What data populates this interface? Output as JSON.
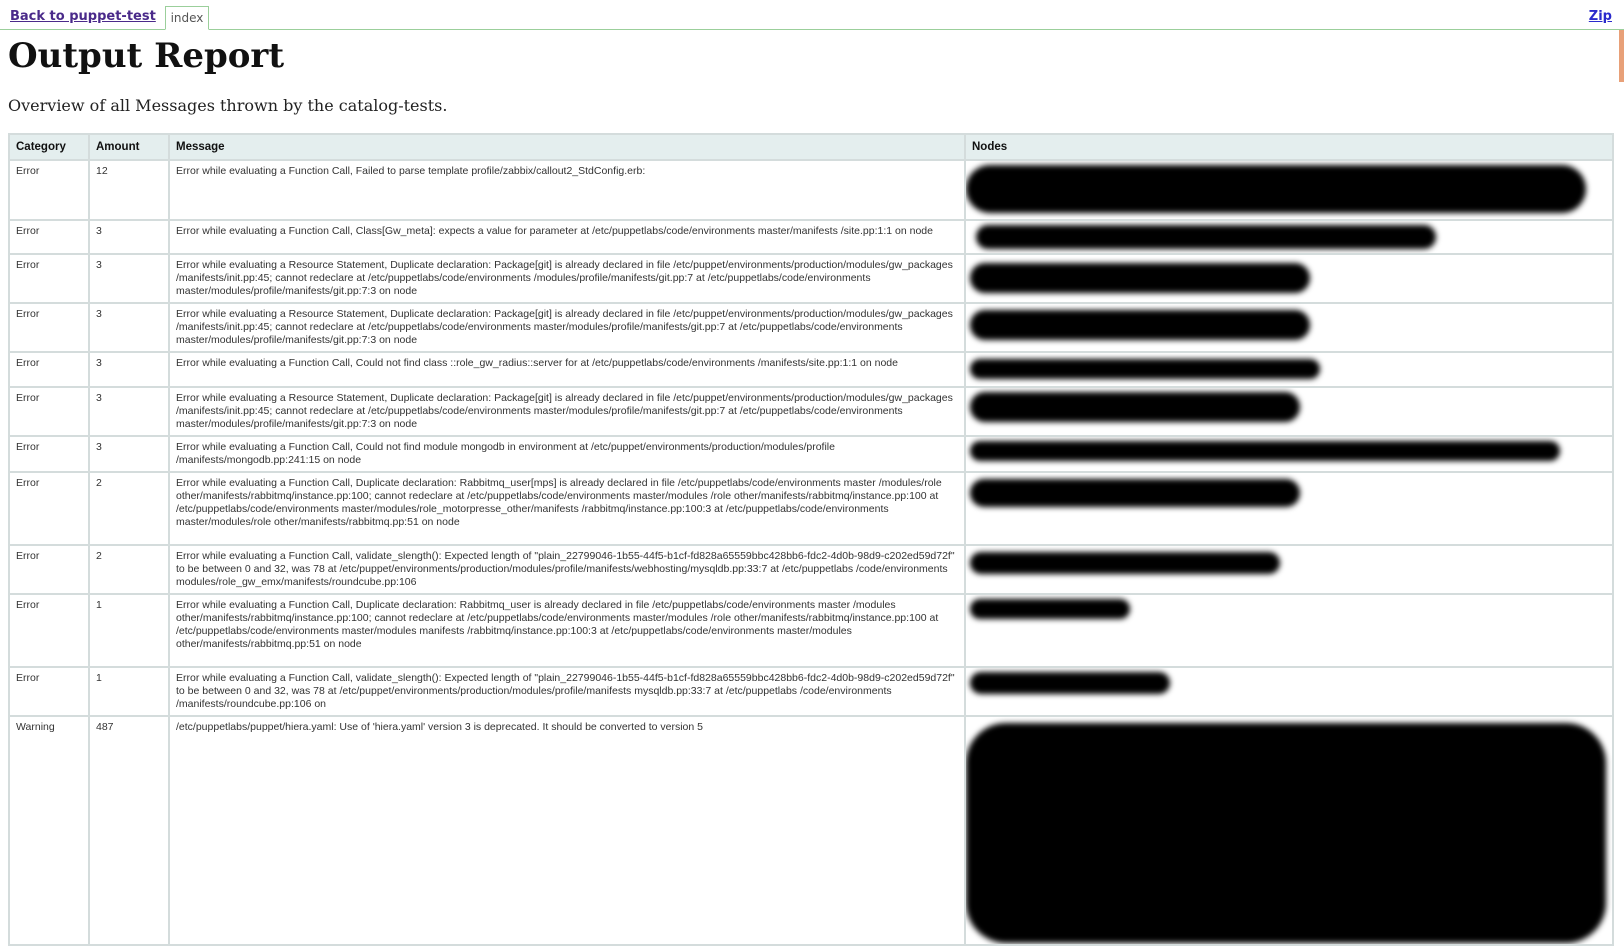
{
  "nav": {
    "back_label": "Back to puppet-test",
    "tab_label": "index",
    "zip_label": "Zip"
  },
  "page": {
    "title": "Output Report",
    "subtitle": "Overview of all Messages thrown by the catalog-tests."
  },
  "table": {
    "headers": [
      "Category",
      "Amount",
      "Message",
      "Nodes"
    ],
    "rows": [
      {
        "category": "Error",
        "amount": "12",
        "message": "Error while evaluating a Function Call, Failed to parse template profile/zabbix/callout2_StdConfig.erb:"
      },
      {
        "category": "Error",
        "amount": "3",
        "message": "Error while evaluating a Function Call, Class[Gw_meta]: expects a value for parameter at /etc/puppetlabs/code/environments master/manifests /site.pp:1:1 on node"
      },
      {
        "category": "Error",
        "amount": "3",
        "message": "Error while evaluating a Resource Statement, Duplicate declaration: Package[git] is already declared in file /etc/puppet/environments/production/modules/gw_packages /manifests/init.pp:45; cannot redeclare at /etc/puppetlabs/code/environments /modules/profile/manifests/git.pp:7 at /etc/puppetlabs/code/environments master/modules/profile/manifests/git.pp:7:3 on node"
      },
      {
        "category": "Error",
        "amount": "3",
        "message": "Error while evaluating a Resource Statement, Duplicate declaration: Package[git] is already declared in file /etc/puppet/environments/production/modules/gw_packages /manifests/init.pp:45; cannot redeclare at /etc/puppetlabs/code/environments master/modules/profile/manifests/git.pp:7 at /etc/puppetlabs/code/environments master/modules/profile/manifests/git.pp:7:3 on node"
      },
      {
        "category": "Error",
        "amount": "3",
        "message": "Error while evaluating a Function Call, Could not find class ::role_gw_radius::server for at /etc/puppetlabs/code/environments /manifests/site.pp:1:1 on node"
      },
      {
        "category": "Error",
        "amount": "3",
        "message": "Error while evaluating a Resource Statement, Duplicate declaration: Package[git] is already declared in file /etc/puppet/environments/production/modules/gw_packages /manifests/init.pp:45; cannot redeclare at /etc/puppetlabs/code/environments master/modules/profile/manifests/git.pp:7 at /etc/puppetlabs/code/environments master/modules/profile/manifests/git.pp:7:3 on node"
      },
      {
        "category": "Error",
        "amount": "3",
        "message": "Error while evaluating a Function Call, Could not find module mongodb in environment at /etc/puppet/environments/production/modules/profile /manifests/mongodb.pp:241:15 on node"
      },
      {
        "category": "Error",
        "amount": "2",
        "message": "Error while evaluating a Function Call, Duplicate declaration: Rabbitmq_user[mps] is already declared in file /etc/puppetlabs/code/environments master /modules/role other/manifests/rabbitmq/instance.pp:100; cannot redeclare at /etc/puppetlabs/code/environments master/modules /role other/manifests/rabbitmq/instance.pp:100 at /etc/puppetlabs/code/environments master/modules/role_motorpresse_other/manifests /rabbitmq/instance.pp:100:3 at /etc/puppetlabs/code/environments master/modules/role other/manifests/rabbitmq.pp:51 on node"
      },
      {
        "category": "Error",
        "amount": "2",
        "message": "Error while evaluating a Function Call, validate_slength(): Expected length of \"plain_22799046-1b55-44f5-b1cf-fd828a65559bbc428bb6-fdc2-4d0b-98d9-c202ed59d72f\" to be between 0 and 32, was 78 at /etc/puppet/environments/production/modules/profile/manifests/webhosting/mysqldb.pp:33:7 at /etc/puppetlabs /code/environments modules/role_gw_emx/manifests/roundcube.pp:106"
      },
      {
        "category": "Error",
        "amount": "1",
        "message": "Error while evaluating a Function Call, Duplicate declaration: Rabbitmq_user is already declared in file /etc/puppetlabs/code/environments master /modules other/manifests/rabbitmq/instance.pp:100; cannot redeclare at /etc/puppetlabs/code/environments master/modules /role other/manifests/rabbitmq/instance.pp:100 at /etc/puppetlabs/code/environments master/modules manifests /rabbitmq/instance.pp:100:3 at /etc/puppetlabs/code/environments master/modules other/manifests/rabbitmq.pp:51 on node"
      },
      {
        "category": "Error",
        "amount": "1",
        "message": "Error while evaluating a Function Call, validate_slength(): Expected length of \"plain_22799046-1b55-44f5-b1cf-fd828a65559bbc428bb6-fdc2-4d0b-98d9-c202ed59d72f\" to be between 0 and 32, was 78 at /etc/puppet/environments/production/modules/profile/manifests mysqldb.pp:33:7 at /etc/puppetlabs /code/environments /manifests/roundcube.pp:106 on"
      },
      {
        "category": "Warning",
        "amount": "487",
        "message": "/etc/puppetlabs/puppet/hiera.yaml: Use of 'hiera.yaml' version 3 is deprecated. It should be converted to version 5"
      }
    ]
  }
}
